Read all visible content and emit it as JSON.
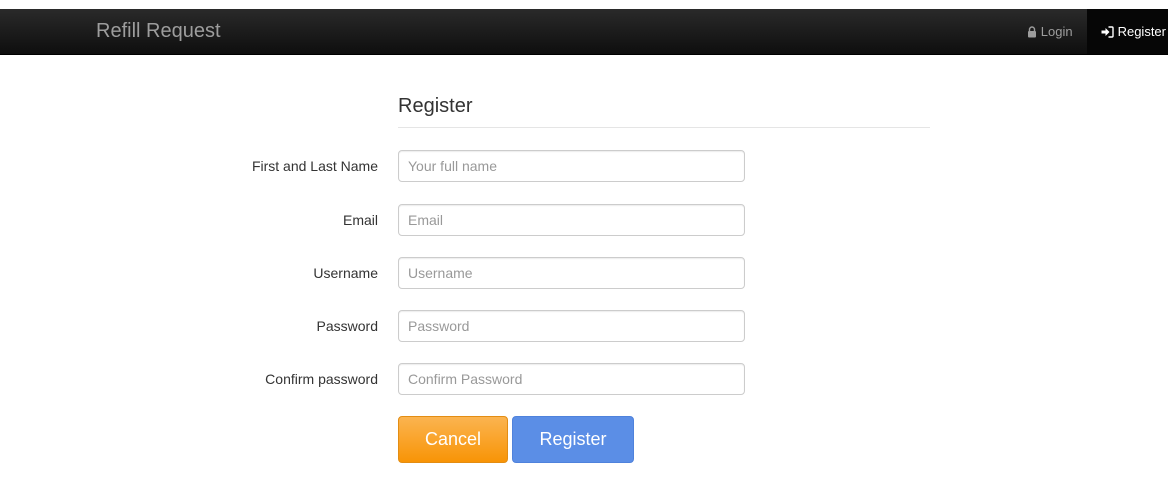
{
  "navbar": {
    "brand": "Refill Request",
    "login_label": "Login",
    "register_label": "Register"
  },
  "form": {
    "legend": "Register",
    "fields": [
      {
        "label": "First and Last Name",
        "placeholder": "Your full name",
        "value": ""
      },
      {
        "label": "Email",
        "placeholder": "Email",
        "value": ""
      },
      {
        "label": "Username",
        "placeholder": "Username",
        "value": ""
      },
      {
        "label": "Password",
        "placeholder": "Password",
        "value": ""
      },
      {
        "label": "Confirm password",
        "placeholder": "Confirm Password",
        "value": ""
      }
    ],
    "cancel_label": "Cancel",
    "submit_label": "Register"
  },
  "colors": {
    "navbar_bg": "#1b1b1b",
    "cancel_button": "#f89406",
    "register_button": "#5b8ee6"
  },
  "icons": {
    "login": "lock-icon",
    "register": "sign-in-icon"
  }
}
